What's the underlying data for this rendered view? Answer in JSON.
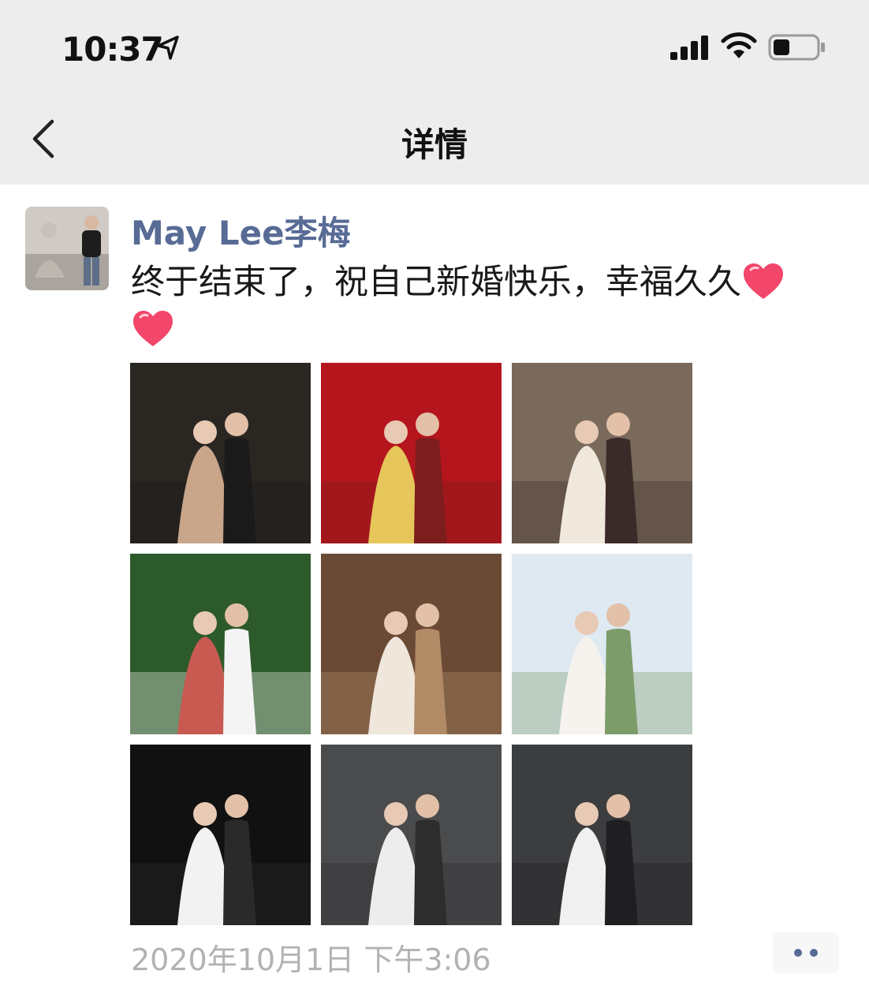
{
  "status_bar": {
    "time": "10:37"
  },
  "nav": {
    "title": "详情"
  },
  "post": {
    "author": "May Lee李梅",
    "text": "终于结束了，祝自己新婚快乐，幸福久久",
    "timestamp": "2020年10月1日 下午3:06",
    "photos": [
      {
        "name": "photo-night-street-wedding",
        "palette": [
          "#2a2622",
          "#c9a58a",
          "#1a1a1a"
        ]
      },
      {
        "name": "photo-red-traditional-wedding",
        "palette": [
          "#b5151d",
          "#e6c65a",
          "#7d1d1d"
        ]
      },
      {
        "name": "photo-street-couple-embrace",
        "palette": [
          "#7a6a5c",
          "#f0e8dc",
          "#3b2b28"
        ]
      },
      {
        "name": "photo-park-sitting-couple",
        "palette": [
          "#2d5a2a",
          "#c85a52",
          "#f4f4f4"
        ]
      },
      {
        "name": "photo-cafe-bride",
        "palette": [
          "#6b4a35",
          "#efe6dc",
          "#b08b66"
        ]
      },
      {
        "name": "photo-outdoor-veil-couple",
        "palette": [
          "#dfe9f2",
          "#f6f3ee",
          "#7c9c6a"
        ]
      },
      {
        "name": "photo-black-studio-couple",
        "palette": [
          "#111111",
          "#f2f2f2",
          "#2a2a2a"
        ]
      },
      {
        "name": "photo-grey-studio-bride",
        "palette": [
          "#4a4b4d",
          "#ededed",
          "#2d2d2d"
        ]
      },
      {
        "name": "photo-grey-studio-couple",
        "palette": [
          "#3c3d3f",
          "#f0f0f0",
          "#1f1f22"
        ]
      }
    ]
  },
  "colors": {
    "author": "#576b95",
    "nav_bg": "#ededed",
    "timestamp": "#b2b2b2",
    "heart": "#f2466a"
  },
  "icons": [
    "location-arrow-icon",
    "signal-icon",
    "wifi-icon",
    "battery-icon",
    "back-chevron-icon",
    "heart-icon",
    "more-dots-icon"
  ]
}
